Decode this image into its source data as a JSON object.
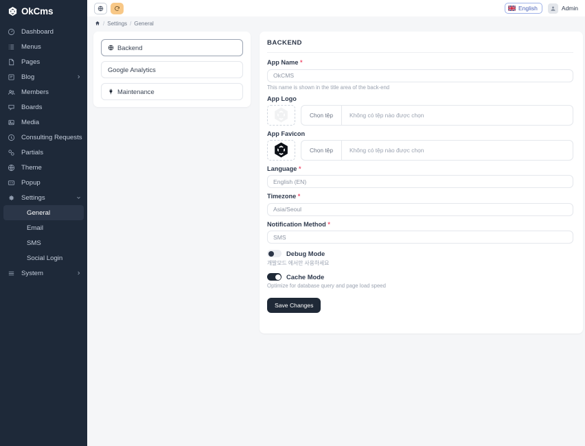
{
  "brand": {
    "name": "OkCms",
    "logo_icon": "okcms-logo-icon"
  },
  "sidebar": {
    "items": [
      {
        "label": "Dashboard",
        "icon": "dashboard-icon",
        "type": "item"
      },
      {
        "label": "Menus",
        "icon": "menus-icon",
        "type": "item"
      },
      {
        "label": "Pages",
        "icon": "pages-icon",
        "type": "item"
      },
      {
        "label": "Blog",
        "icon": "blog-icon",
        "type": "item",
        "chevron": "chevron-right-icon"
      },
      {
        "label": "Members",
        "icon": "members-icon",
        "type": "item"
      },
      {
        "label": "Boards",
        "icon": "boards-icon",
        "type": "item"
      },
      {
        "label": "Media",
        "icon": "media-icon",
        "type": "item"
      },
      {
        "label": "Consulting Requests",
        "icon": "consulting-icon",
        "type": "item"
      },
      {
        "label": "Partials",
        "icon": "partials-icon",
        "type": "item"
      },
      {
        "label": "Theme",
        "icon": "theme-icon",
        "type": "item"
      },
      {
        "label": "Popup",
        "icon": "popup-icon",
        "type": "item"
      },
      {
        "label": "Settings",
        "icon": "gear-icon",
        "type": "item",
        "chevron": "chevron-down-icon",
        "expanded": true
      }
    ],
    "settings_children": [
      {
        "label": "General",
        "active": true
      },
      {
        "label": "Email",
        "active": false
      },
      {
        "label": "SMS",
        "active": false
      },
      {
        "label": "Social Login",
        "active": false
      }
    ],
    "trailing": [
      {
        "label": "System",
        "icon": "system-icon",
        "type": "item",
        "chevron": "chevron-right-icon"
      }
    ]
  },
  "topbar": {
    "site_button_icon": "globe-icon",
    "refresh_button_icon": "refresh-icon",
    "refresh_button_color": "#f8c887",
    "language_label": "English",
    "language_flag": "uk-flag-icon",
    "user_name": "Admin",
    "avatar_icon": "user-avatar-icon"
  },
  "breadcrumb": {
    "home_icon": "home-icon",
    "separator": "/",
    "items": [
      "Settings",
      "General"
    ]
  },
  "settings_groups": [
    {
      "label": "Backend",
      "icon": "globe-icon",
      "selected": true
    },
    {
      "label": "Google Analytics",
      "icon": null,
      "selected": false
    },
    {
      "label": "Maintenance",
      "icon": "plug-icon",
      "selected": false
    }
  ],
  "form": {
    "section_title": "BACKEND",
    "app_name": {
      "label": "App Name",
      "required": "*",
      "value": "OkCMS",
      "placeholder": "OkCMS",
      "help": "This name is shown in the title area of the back-end"
    },
    "app_logo": {
      "label": "App Logo",
      "thumb_icon": "okcms-logo-icon",
      "choose_label": "Chọn tệp",
      "no_file_label": "Không có tệp nào được chọn"
    },
    "app_favicon": {
      "label": "App Favicon",
      "thumb_icon": "okcms-logo-icon",
      "choose_label": "Chọn tệp",
      "no_file_label": "Không có tệp nào được chọn"
    },
    "language": {
      "label": "Language",
      "required": "*",
      "value": "English (EN)"
    },
    "timezone": {
      "label": "Timezone",
      "required": "*",
      "value": "Asia/Seoul"
    },
    "notification_method": {
      "label": "Notification Method",
      "required": "*",
      "value": "SMS"
    },
    "debug_mode": {
      "label": "Debug Mode",
      "state": "off",
      "help": "개발모드 에서만 사용하세요"
    },
    "cache_mode": {
      "label": "Cache Mode",
      "state": "on",
      "help": "Optimize for database query and page load speed"
    },
    "save_label": "Save Changes"
  }
}
